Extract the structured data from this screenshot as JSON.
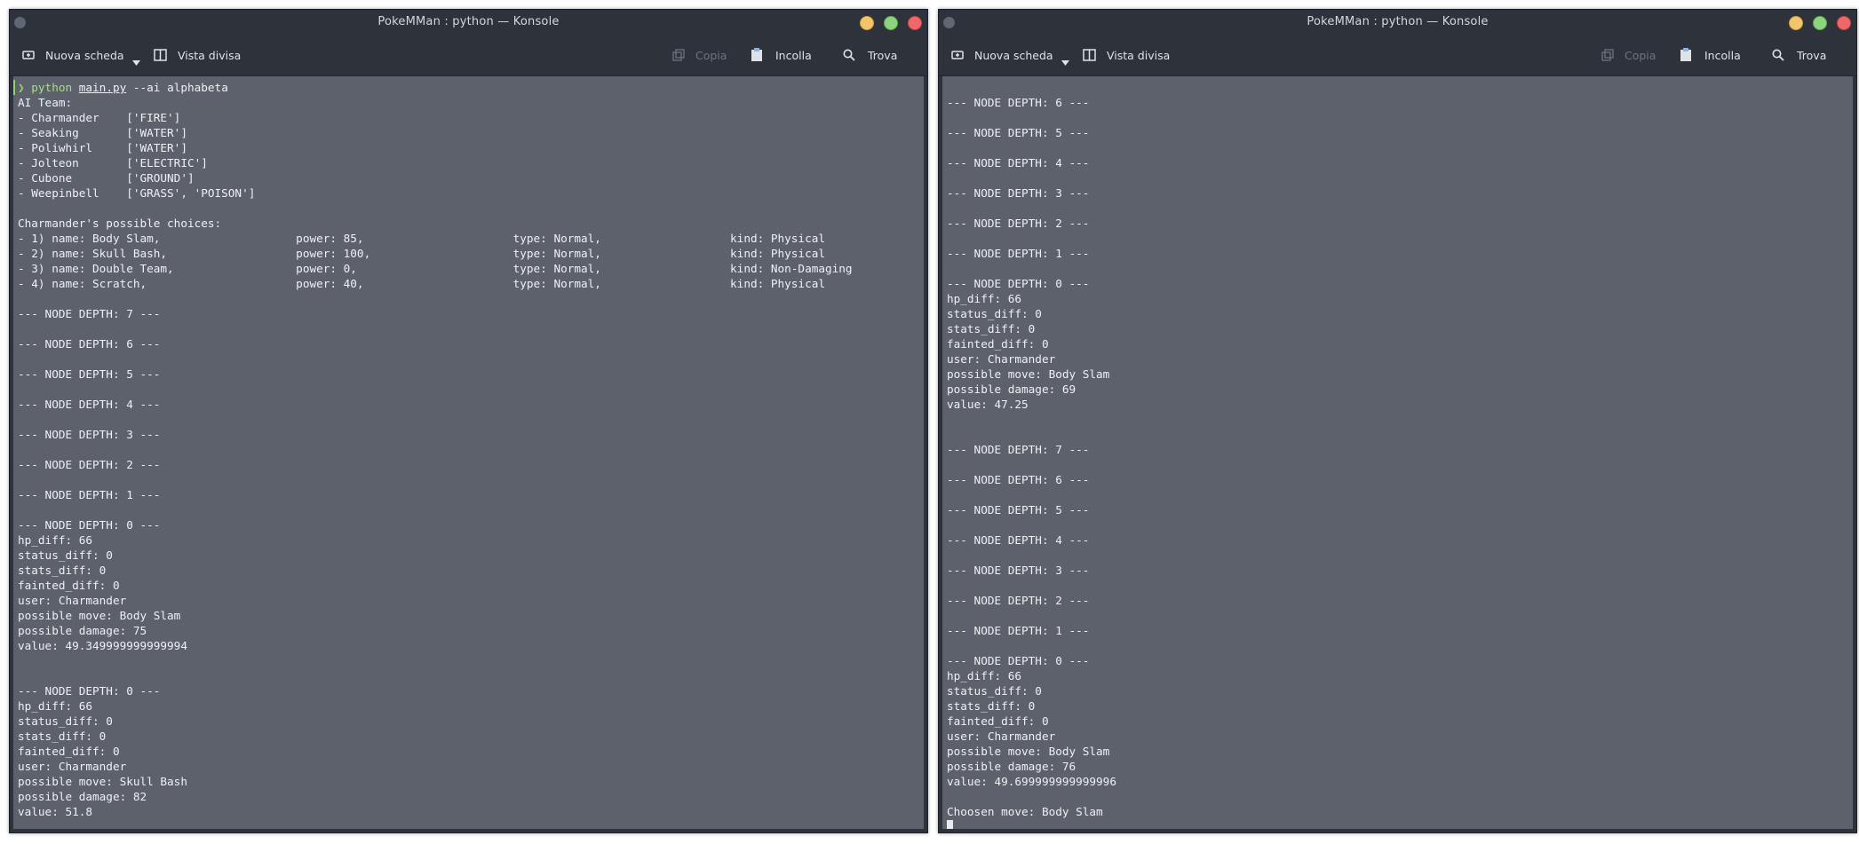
{
  "windows": [
    {
      "title": "PokeMMan : python — Konsole",
      "toolbar": {
        "new_tab": "Nuova scheda",
        "split_view": "Vista divisa",
        "copy": "Copia",
        "paste": "Incolla",
        "find": "Trova"
      },
      "prompt": {
        "arrow": "❯",
        "python": "python",
        "file": "main.py",
        "args": " --ai alphabeta"
      },
      "output": "AI Team:\n- Charmander    ['FIRE']\n- Seaking       ['WATER']\n- Poliwhirl     ['WATER']\n- Jolteon       ['ELECTRIC']\n- Cubone        ['GROUND']\n- Weepinbell    ['GRASS', 'POISON']\n\nCharmander's possible choices:\n- 1) name: Body Slam,                    power: 85,                      type: Normal,                   kind: Physical\n- 2) name: Skull Bash,                   power: 100,                     type: Normal,                   kind: Physical\n- 3) name: Double Team,                  power: 0,                       type: Normal,                   kind: Non-Damaging\n- 4) name: Scratch,                      power: 40,                      type: Normal,                   kind: Physical\n\n--- NODE DEPTH: 7 ---\n\n--- NODE DEPTH: 6 ---\n\n--- NODE DEPTH: 5 ---\n\n--- NODE DEPTH: 4 ---\n\n--- NODE DEPTH: 3 ---\n\n--- NODE DEPTH: 2 ---\n\n--- NODE DEPTH: 1 ---\n\n--- NODE DEPTH: 0 ---\nhp_diff: 66\nstatus_diff: 0\nstats_diff: 0\nfainted_diff: 0\nuser: Charmander\npossible move: Body Slam\npossible damage: 75\nvalue: 49.349999999999994\n\n\n--- NODE DEPTH: 0 ---\nhp_diff: 66\nstatus_diff: 0\nstats_diff: 0\nfainted_diff: 0\nuser: Charmander\npossible move: Skull Bash\npossible damage: 82\nvalue: 51.8"
    },
    {
      "title": "PokeMMan : python — Konsole",
      "toolbar": {
        "new_tab": "Nuova scheda",
        "split_view": "Vista divisa",
        "copy": "Copia",
        "paste": "Incolla",
        "find": "Trova"
      },
      "output": "\n--- NODE DEPTH: 6 ---\n\n--- NODE DEPTH: 5 ---\n\n--- NODE DEPTH: 4 ---\n\n--- NODE DEPTH: 3 ---\n\n--- NODE DEPTH: 2 ---\n\n--- NODE DEPTH: 1 ---\n\n--- NODE DEPTH: 0 ---\nhp_diff: 66\nstatus_diff: 0\nstats_diff: 0\nfainted_diff: 0\nuser: Charmander\npossible move: Body Slam\npossible damage: 69\nvalue: 47.25\n\n\n--- NODE DEPTH: 7 ---\n\n--- NODE DEPTH: 6 ---\n\n--- NODE DEPTH: 5 ---\n\n--- NODE DEPTH: 4 ---\n\n--- NODE DEPTH: 3 ---\n\n--- NODE DEPTH: 2 ---\n\n--- NODE DEPTH: 1 ---\n\n--- NODE DEPTH: 0 ---\nhp_diff: 66\nstatus_diff: 0\nstats_diff: 0\nfainted_diff: 0\nuser: Charmander\npossible move: Body Slam\npossible damage: 76\nvalue: 49.699999999999996\n\nChoosen move: Body Slam\n"
    }
  ],
  "colors": {
    "terminal_bg": "#5c616c",
    "chrome_bg": "#2e323b",
    "prompt_green": "#8fd36b"
  }
}
